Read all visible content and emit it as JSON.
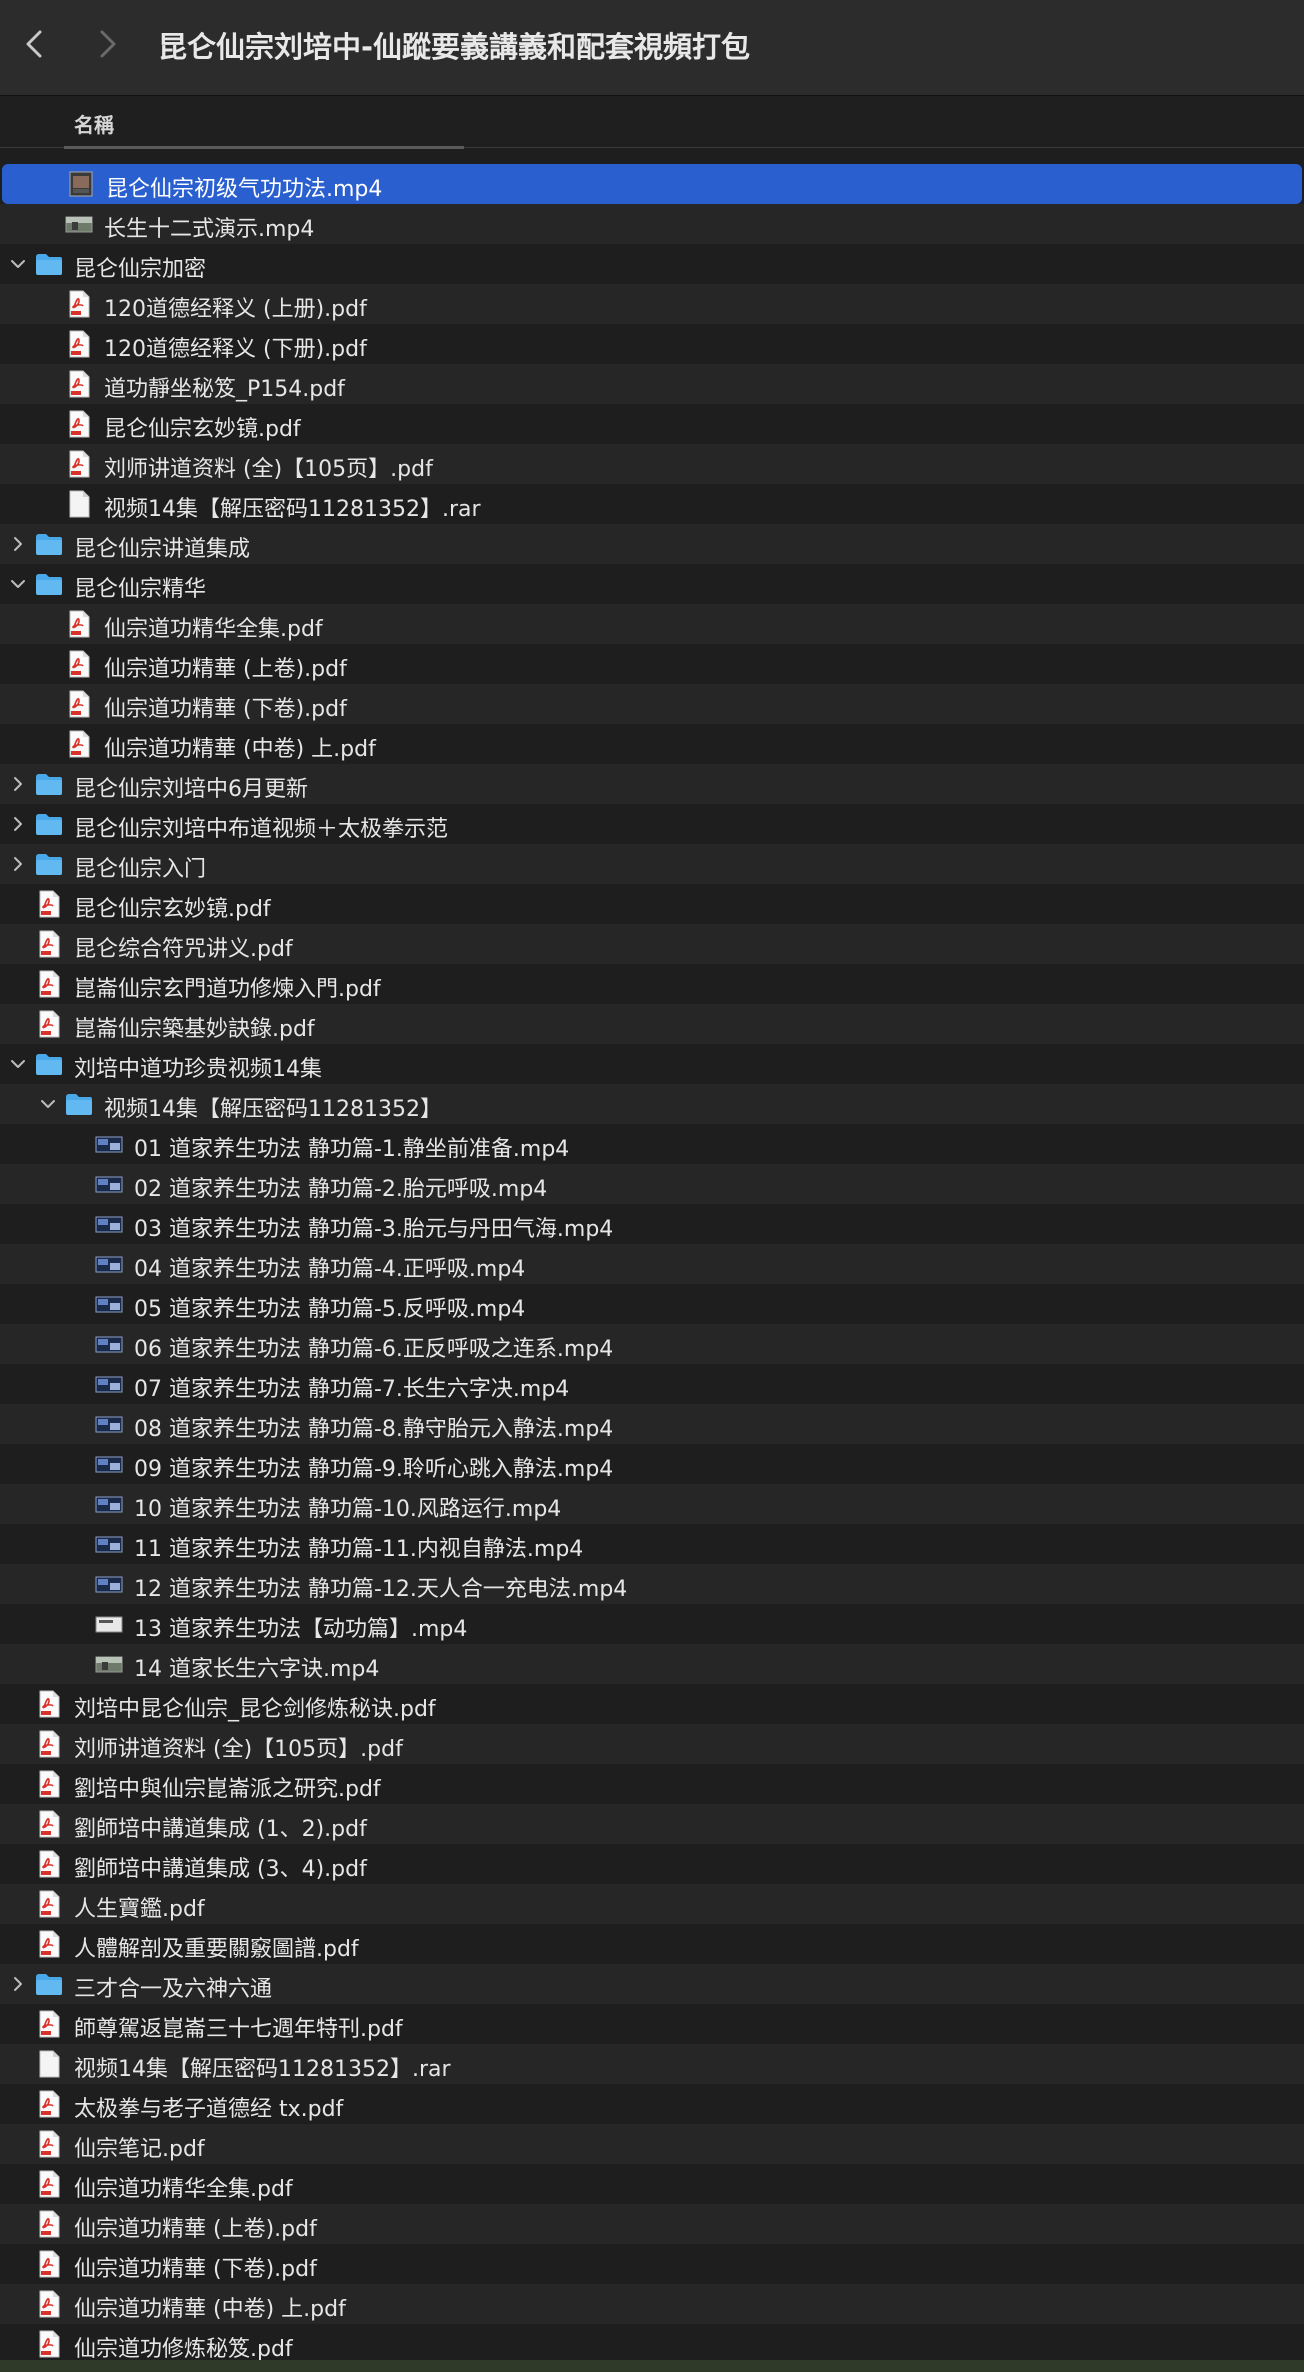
{
  "window": {
    "title": "昆仑仙宗刘培中-仙蹤要義講義和配套視頻打包",
    "back_icon": "chevron-left-icon",
    "forward_icon": "chevron-right-icon"
  },
  "header": {
    "column_name": "名稱"
  },
  "rows": [
    {
      "label": "昆仑仙宗初级气功功法.mp4",
      "icon": "video-thumb",
      "depth": 1,
      "expand": "none",
      "selected": true
    },
    {
      "label": "长生十二式演示.mp4",
      "icon": "video-thumb-landscape",
      "depth": 1,
      "expand": "none",
      "selected": false
    },
    {
      "label": "昆仑仙宗加密",
      "icon": "folder",
      "depth": 0,
      "expand": "open",
      "selected": false
    },
    {
      "label": "120道德经释义 (上册).pdf",
      "icon": "pdf",
      "depth": 1,
      "expand": "none",
      "selected": false
    },
    {
      "label": "120道德经释义 (下册).pdf",
      "icon": "pdf",
      "depth": 1,
      "expand": "none",
      "selected": false
    },
    {
      "label": "道功靜坐秘笈_P154.pdf",
      "icon": "pdf",
      "depth": 1,
      "expand": "none",
      "selected": false
    },
    {
      "label": "昆仑仙宗玄妙镜.pdf",
      "icon": "pdf",
      "depth": 1,
      "expand": "none",
      "selected": false
    },
    {
      "label": "刘师讲道资料 (全)【105页】.pdf",
      "icon": "pdf",
      "depth": 1,
      "expand": "none",
      "selected": false
    },
    {
      "label": "视频14集【解压密码11281352】.rar",
      "icon": "document",
      "depth": 1,
      "expand": "none",
      "selected": false
    },
    {
      "label": "昆仑仙宗讲道集成",
      "icon": "folder",
      "depth": 0,
      "expand": "closed",
      "selected": false
    },
    {
      "label": "昆仑仙宗精华",
      "icon": "folder",
      "depth": 0,
      "expand": "open",
      "selected": false
    },
    {
      "label": "仙宗道功精华全集.pdf",
      "icon": "pdf",
      "depth": 1,
      "expand": "none",
      "selected": false
    },
    {
      "label": "仙宗道功精華 (上卷).pdf",
      "icon": "pdf",
      "depth": 1,
      "expand": "none",
      "selected": false
    },
    {
      "label": "仙宗道功精華 (下卷).pdf",
      "icon": "pdf",
      "depth": 1,
      "expand": "none",
      "selected": false
    },
    {
      "label": "仙宗道功精華 (中卷) 上.pdf",
      "icon": "pdf",
      "depth": 1,
      "expand": "none",
      "selected": false
    },
    {
      "label": "昆仑仙宗刘培中6月更新",
      "icon": "folder",
      "depth": 0,
      "expand": "closed",
      "selected": false
    },
    {
      "label": "昆仑仙宗刘培中布道视频＋太极拳示范",
      "icon": "folder",
      "depth": 0,
      "expand": "closed",
      "selected": false
    },
    {
      "label": "昆仑仙宗入门",
      "icon": "folder",
      "depth": 0,
      "expand": "closed",
      "selected": false
    },
    {
      "label": "昆仑仙宗玄妙镜.pdf",
      "icon": "pdf",
      "depth": 0,
      "expand": "none",
      "selected": false
    },
    {
      "label": "昆仑综合符咒讲义.pdf",
      "icon": "pdf",
      "depth": 0,
      "expand": "none",
      "selected": false
    },
    {
      "label": "崑崙仙宗玄門道功修煉入門.pdf",
      "icon": "pdf",
      "depth": 0,
      "expand": "none",
      "selected": false
    },
    {
      "label": "崑崙仙宗築基妙訣錄.pdf",
      "icon": "pdf",
      "depth": 0,
      "expand": "none",
      "selected": false
    },
    {
      "label": "刘培中道功珍贵视频14集",
      "icon": "folder",
      "depth": 0,
      "expand": "open",
      "selected": false
    },
    {
      "label": "视频14集【解压密码11281352】",
      "icon": "folder",
      "depth": 1,
      "expand": "open",
      "selected": false
    },
    {
      "label": "01 道家养生功法 静功篇-1.静坐前准备.mp4",
      "icon": "video-thumb-blue",
      "depth": 2,
      "expand": "none",
      "selected": false
    },
    {
      "label": "02 道家养生功法 静功篇-2.胎元呼吸.mp4",
      "icon": "video-thumb-blue",
      "depth": 2,
      "expand": "none",
      "selected": false
    },
    {
      "label": "03 道家养生功法 静功篇-3.胎元与丹田气海.mp4",
      "icon": "video-thumb-blue",
      "depth": 2,
      "expand": "none",
      "selected": false
    },
    {
      "label": "04 道家养生功法 静功篇-4.正呼吸.mp4",
      "icon": "video-thumb-blue",
      "depth": 2,
      "expand": "none",
      "selected": false
    },
    {
      "label": "05 道家养生功法 静功篇-5.反呼吸.mp4",
      "icon": "video-thumb-blue",
      "depth": 2,
      "expand": "none",
      "selected": false
    },
    {
      "label": "06 道家养生功法 静功篇-6.正反呼吸之连系.mp4",
      "icon": "video-thumb-blue",
      "depth": 2,
      "expand": "none",
      "selected": false
    },
    {
      "label": "07 道家养生功法 静功篇-7.长生六字决.mp4",
      "icon": "video-thumb-blue",
      "depth": 2,
      "expand": "none",
      "selected": false
    },
    {
      "label": "08 道家养生功法 静功篇-8.静守胎元入静法.mp4",
      "icon": "video-thumb-blue",
      "depth": 2,
      "expand": "none",
      "selected": false
    },
    {
      "label": "09 道家养生功法 静功篇-9.聆听心跳入静法.mp4",
      "icon": "video-thumb-blue",
      "depth": 2,
      "expand": "none",
      "selected": false
    },
    {
      "label": "10 道家养生功法 静功篇-10.风路运行.mp4",
      "icon": "video-thumb-blue",
      "depth": 2,
      "expand": "none",
      "selected": false
    },
    {
      "label": "11 道家养生功法 静功篇-11.内视自静法.mp4",
      "icon": "video-thumb-blue",
      "depth": 2,
      "expand": "none",
      "selected": false
    },
    {
      "label": "12 道家养生功法 静功篇-12.天人合一充电法.mp4",
      "icon": "video-thumb-blue",
      "depth": 2,
      "expand": "none",
      "selected": false
    },
    {
      "label": "13 道家养生功法【动功篇】.mp4",
      "icon": "video-thumb-white",
      "depth": 2,
      "expand": "none",
      "selected": false
    },
    {
      "label": "14 道家长生六字诀.mp4",
      "icon": "video-thumb-landscape",
      "depth": 2,
      "expand": "none",
      "selected": false
    },
    {
      "label": "刘培中昆仑仙宗_昆仑剑修炼秘诀.pdf",
      "icon": "pdf",
      "depth": 0,
      "expand": "none",
      "selected": false
    },
    {
      "label": "刘师讲道资料 (全)【105页】.pdf",
      "icon": "pdf",
      "depth": 0,
      "expand": "none",
      "selected": false
    },
    {
      "label": "劉培中與仙宗崑崙派之研究.pdf",
      "icon": "pdf",
      "depth": 0,
      "expand": "none",
      "selected": false
    },
    {
      "label": "劉師培中講道集成 (1、2).pdf",
      "icon": "pdf",
      "depth": 0,
      "expand": "none",
      "selected": false
    },
    {
      "label": "劉師培中講道集成 (3、4).pdf",
      "icon": "pdf",
      "depth": 0,
      "expand": "none",
      "selected": false
    },
    {
      "label": "人生寶鑑.pdf",
      "icon": "pdf",
      "depth": 0,
      "expand": "none",
      "selected": false
    },
    {
      "label": "人體解剖及重要關竅圖譜.pdf",
      "icon": "pdf",
      "depth": 0,
      "expand": "none",
      "selected": false
    },
    {
      "label": "三才合一及六神六通",
      "icon": "folder",
      "depth": 0,
      "expand": "closed",
      "selected": false
    },
    {
      "label": "師尊駕返崑崙三十七週年特刊.pdf",
      "icon": "pdf",
      "depth": 0,
      "expand": "none",
      "selected": false
    },
    {
      "label": "视频14集【解压密码11281352】.rar",
      "icon": "document",
      "depth": 0,
      "expand": "none",
      "selected": false
    },
    {
      "label": "太极拳与老子道德经 tx.pdf",
      "icon": "pdf",
      "depth": 0,
      "expand": "none",
      "selected": false
    },
    {
      "label": "仙宗笔记.pdf",
      "icon": "pdf",
      "depth": 0,
      "expand": "none",
      "selected": false
    },
    {
      "label": "仙宗道功精华全集.pdf",
      "icon": "pdf",
      "depth": 0,
      "expand": "none",
      "selected": false
    },
    {
      "label": "仙宗道功精華 (上卷).pdf",
      "icon": "pdf",
      "depth": 0,
      "expand": "none",
      "selected": false
    },
    {
      "label": "仙宗道功精華 (下卷).pdf",
      "icon": "pdf",
      "depth": 0,
      "expand": "none",
      "selected": false
    },
    {
      "label": "仙宗道功精華 (中卷) 上.pdf",
      "icon": "pdf",
      "depth": 0,
      "expand": "none",
      "selected": false
    },
    {
      "label": "仙宗道功修炼秘笈.pdf",
      "icon": "pdf",
      "depth": 0,
      "expand": "none",
      "selected": false
    }
  ],
  "colors": {
    "selection": "#2a5fcf",
    "folder": "#4aa8e8",
    "pdf_red": "#d8322b"
  }
}
